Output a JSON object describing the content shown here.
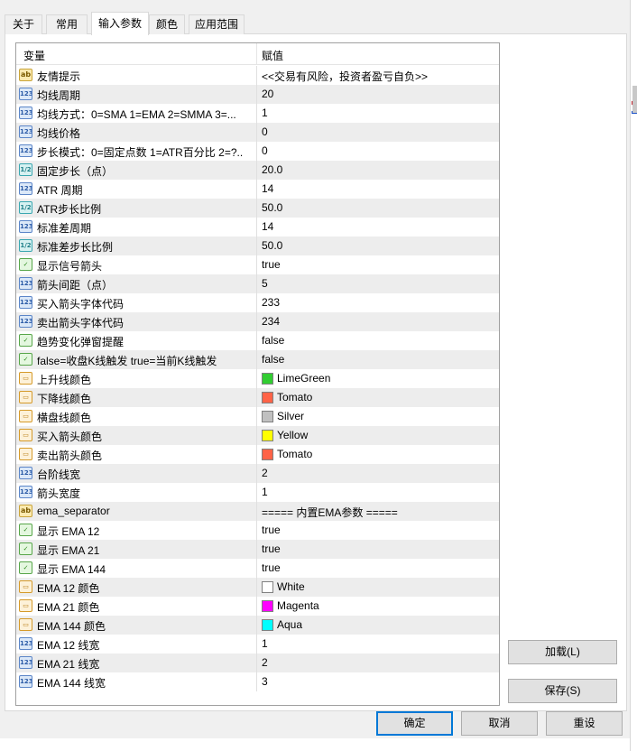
{
  "tabs": [
    {
      "label": "关于"
    },
    {
      "label": "常用"
    },
    {
      "label": "输入参数"
    },
    {
      "label": "颜色"
    },
    {
      "label": "应用范围"
    }
  ],
  "active_tab": "输入参数",
  "table": {
    "col_variable": "变量",
    "col_value": "赋值",
    "rows": [
      {
        "type": "str",
        "type_icon": "text-type-icon",
        "name": "友情提示",
        "value": "<<交易有风险，投资者盈亏自负>>"
      },
      {
        "type": "num",
        "type_icon": "integer-type-icon",
        "name": "均线周期",
        "value": "20"
      },
      {
        "type": "num",
        "type_icon": "integer-type-icon",
        "name": "均线方式：0=SMA 1=EMA 2=SMMA 3=...",
        "value": "1"
      },
      {
        "type": "num",
        "type_icon": "integer-type-icon",
        "name": "均线价格",
        "value": "0"
      },
      {
        "type": "num",
        "type_icon": "integer-type-icon",
        "name": "步长模式：0=固定点数 1=ATR百分比 2=?..",
        "value": "0"
      },
      {
        "type": "dbl",
        "type_icon": "double-type-icon",
        "name": "固定步长（点）",
        "value": "20.0"
      },
      {
        "type": "num",
        "type_icon": "integer-type-icon",
        "name": "ATR 周期",
        "value": "14"
      },
      {
        "type": "dbl",
        "type_icon": "double-type-icon",
        "name": "ATR步长比例",
        "value": "50.0"
      },
      {
        "type": "num",
        "type_icon": "integer-type-icon",
        "name": "标准差周期",
        "value": "14"
      },
      {
        "type": "dbl",
        "type_icon": "double-type-icon",
        "name": "标准差步长比例",
        "value": "50.0"
      },
      {
        "type": "bool",
        "type_icon": "boolean-type-icon",
        "name": "显示信号箭头",
        "value": "true"
      },
      {
        "type": "num",
        "type_icon": "integer-type-icon",
        "name": "箭头间距（点）",
        "value": "5"
      },
      {
        "type": "num",
        "type_icon": "integer-type-icon",
        "name": "买入箭头字体代码",
        "value": "233"
      },
      {
        "type": "num",
        "type_icon": "integer-type-icon",
        "name": "卖出箭头字体代码",
        "value": "234"
      },
      {
        "type": "bool",
        "type_icon": "boolean-type-icon",
        "name": "趋势变化弹窗提醒",
        "value": "false"
      },
      {
        "type": "bool",
        "type_icon": "boolean-type-icon",
        "name": "false=收盘K线触发 true=当前K线触发",
        "value": "false"
      },
      {
        "type": "color",
        "type_icon": "color-type-icon",
        "name": "上升线颜色",
        "value": "LimeGreen",
        "swatch": "#32cd32"
      },
      {
        "type": "color",
        "type_icon": "color-type-icon",
        "name": "下降线颜色",
        "value": "Tomato",
        "swatch": "#ff6347"
      },
      {
        "type": "color",
        "type_icon": "color-type-icon",
        "name": "横盘线颜色",
        "value": "Silver",
        "swatch": "#c0c0c0"
      },
      {
        "type": "color",
        "type_icon": "color-type-icon",
        "name": "买入箭头颜色",
        "value": "Yellow",
        "swatch": "#ffff00"
      },
      {
        "type": "color",
        "type_icon": "color-type-icon",
        "name": "卖出箭头颜色",
        "value": "Tomato",
        "swatch": "#ff6347"
      },
      {
        "type": "num",
        "type_icon": "integer-type-icon",
        "name": "台阶线宽",
        "value": "2"
      },
      {
        "type": "num",
        "type_icon": "integer-type-icon",
        "name": "箭头宽度",
        "value": "1"
      },
      {
        "type": "str",
        "type_icon": "text-type-icon",
        "name": "ema_separator",
        "value": "===== 内置EMA参数 ====="
      },
      {
        "type": "bool",
        "type_icon": "boolean-type-icon",
        "name": "显示 EMA 12",
        "value": "true"
      },
      {
        "type": "bool",
        "type_icon": "boolean-type-icon",
        "name": "显示 EMA 21",
        "value": "true"
      },
      {
        "type": "bool",
        "type_icon": "boolean-type-icon",
        "name": "显示 EMA 144",
        "value": "true"
      },
      {
        "type": "color",
        "type_icon": "color-type-icon",
        "name": "EMA 12 颜色",
        "value": "White",
        "swatch": "#ffffff"
      },
      {
        "type": "color",
        "type_icon": "color-type-icon",
        "name": "EMA 21 颜色",
        "value": "Magenta",
        "swatch": "#ff00ff"
      },
      {
        "type": "color",
        "type_icon": "color-type-icon",
        "name": "EMA 144 颜色",
        "value": "Aqua",
        "swatch": "#00ffff"
      },
      {
        "type": "num",
        "type_icon": "integer-type-icon",
        "name": "EMA 12 线宽",
        "value": "1"
      },
      {
        "type": "num",
        "type_icon": "integer-type-icon",
        "name": "EMA 21 线宽",
        "value": "2"
      },
      {
        "type": "num",
        "type_icon": "integer-type-icon",
        "name": "EMA 144 线宽",
        "value": "3"
      }
    ]
  },
  "icon_glyphs": {
    "num": "123",
    "dbl": "1/2",
    "str": "ab",
    "bool": "✓",
    "color": "▭"
  },
  "buttons": {
    "load": "加载(L)",
    "save": "保存(S)",
    "ok": "确定",
    "cancel": "取消",
    "reset": "重设"
  },
  "colors": {
    "accent": "#0078d7",
    "row_alt": "#ededed"
  }
}
